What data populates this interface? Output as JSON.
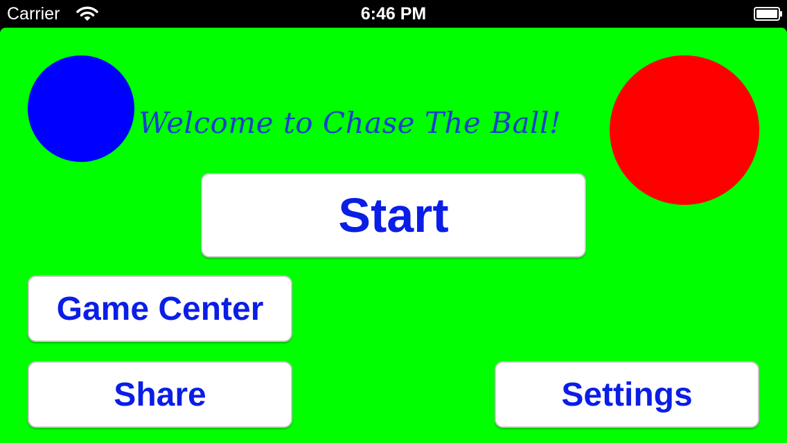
{
  "status_bar": {
    "carrier": "Carrier",
    "time": "6:46 PM",
    "wifi_icon": "wifi-icon",
    "battery_icon": "battery-icon"
  },
  "app": {
    "background_color": "#00ff00",
    "title": "Welcome to Chase The Ball!",
    "title_color": "#1a3fcf",
    "text_color": "#0a1ee6",
    "blue_ball_color": "#0000ff",
    "red_ball_color": "#ff0000",
    "buttons": {
      "start": "Start",
      "game_center": "Game Center",
      "share": "Share",
      "settings": "Settings"
    }
  }
}
